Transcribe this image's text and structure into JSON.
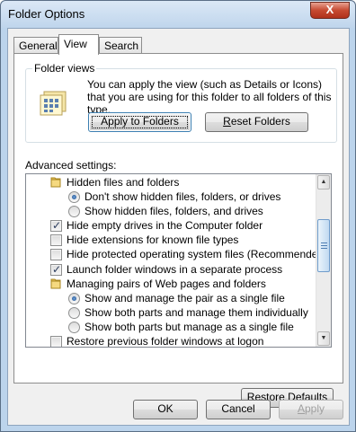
{
  "window": {
    "title": "Folder Options",
    "close_glyph": "X"
  },
  "tabs": [
    {
      "label": "General",
      "active": false
    },
    {
      "label": "View",
      "active": true
    },
    {
      "label": "Search",
      "active": false
    }
  ],
  "folder_views": {
    "group_label": "Folder views",
    "description": "You can apply the view (such as Details or Icons) that you are using for this folder to all folders of this type.",
    "icon": "folder-views-icon",
    "apply_button": "Apply to Folders",
    "reset_button_prefix": "",
    "reset_button_access": "R",
    "reset_button_rest": "eset Folders"
  },
  "advanced": {
    "label": "Advanced settings:",
    "items": [
      {
        "kind": "folder",
        "label": "Hidden files and folders",
        "indent": 0
      },
      {
        "kind": "radio",
        "checked": true,
        "label": "Don't show hidden files, folders, or drives",
        "indent": 1
      },
      {
        "kind": "radio",
        "checked": false,
        "label": "Show hidden files, folders, and drives",
        "indent": 1
      },
      {
        "kind": "checkbox",
        "checked": true,
        "label": "Hide empty drives in the Computer folder",
        "indent": 0
      },
      {
        "kind": "checkbox",
        "checked": false,
        "label": "Hide extensions for known file types",
        "indent": 0
      },
      {
        "kind": "checkbox",
        "checked": false,
        "label": "Hide protected operating system files (Recommended)",
        "indent": 0
      },
      {
        "kind": "checkbox",
        "checked": true,
        "label": "Launch folder windows in a separate process",
        "indent": 0
      },
      {
        "kind": "folder",
        "label": "Managing pairs of Web pages and folders",
        "indent": 0
      },
      {
        "kind": "radio",
        "checked": true,
        "label": "Show and manage the pair as a single file",
        "indent": 1
      },
      {
        "kind": "radio",
        "checked": false,
        "label": "Show both parts and manage them individually",
        "indent": 1
      },
      {
        "kind": "radio",
        "checked": false,
        "label": "Show both parts but manage as a single file",
        "indent": 1
      },
      {
        "kind": "checkbox",
        "checked": false,
        "label": "Restore previous folder windows at logon",
        "indent": 0
      }
    ],
    "scroll_fraction": 0.33
  },
  "restore_defaults": {
    "prefix": "Restore ",
    "access": "D",
    "rest": "efaults"
  },
  "footer": {
    "ok": "OK",
    "cancel": "Cancel",
    "apply_prefix": "",
    "apply_access": "A",
    "apply_rest": "pply"
  },
  "colors": {
    "window_frame": "#bcd4ec",
    "client_bg": "#f0f0f0",
    "disabled_text": "#a0a0a0",
    "close_button": "#c64a31"
  }
}
